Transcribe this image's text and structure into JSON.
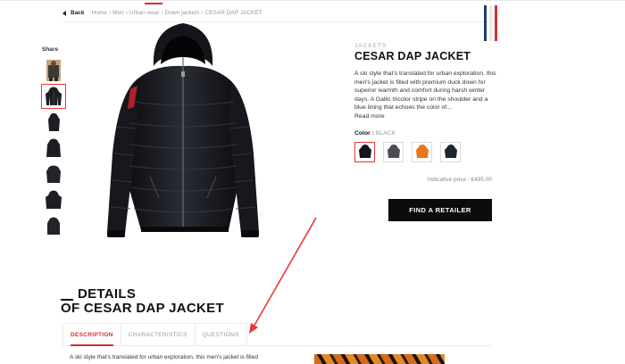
{
  "breadcrumb": {
    "back_label": "Back",
    "items": [
      "Home",
      "Men",
      "Urban wear",
      "Down jackets",
      "CESAR DAP JACKET"
    ]
  },
  "share_label": "Share",
  "product": {
    "category": "JACKETS",
    "title": "CESAR DAP JACKET",
    "description": "A ski style that's translated for urban exploration, this men's jacket is filled with premium duck down for superior warmth and comfort during harsh winter days. A Gallic tricolor stripe on the shoulder and a blue lining that echoes the color of...",
    "read_more": "Read more",
    "color_label": "Color : ",
    "color_value": "BLACK",
    "price": "Indicative price : €495.00",
    "retailer_button": "FIND A RETAILER"
  },
  "details": {
    "line1": "DETAILS",
    "line2": "OF CESAR DAP JACKET"
  },
  "tabs": [
    "DESCRIPTION",
    "CHARACTERISTICS",
    "QUESTIONS"
  ],
  "body_text": "A ski style that's translated for urban exploration, this men's jacket is filled",
  "colors": {
    "accent": "#d32f2f",
    "button_bg": "#0b0b0b",
    "flag_blue": "#1f3a6e",
    "flag_white": "#ffffff",
    "flag_red": "#d32f2f"
  },
  "swatches": [
    "black",
    "grey",
    "orange",
    "navy"
  ]
}
